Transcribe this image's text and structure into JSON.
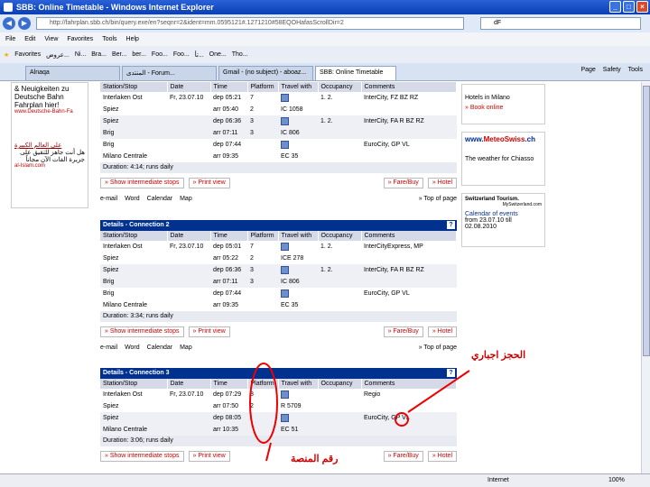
{
  "window": {
    "title": "SBB: Online Timetable - Windows Internet Explorer"
  },
  "address": {
    "url": "http://fahrplan.sbb.ch/bin/query.exe/en?seqnr=2&ident=mm.0595121#.1271210#58EQOHafasScrollDir=2",
    "search": "dF"
  },
  "menu": [
    "File",
    "Edit",
    "View",
    "Favorites",
    "Tools",
    "Help"
  ],
  "favorites": {
    "label": "Favorites",
    "items": [
      "عروض...",
      "Ni...",
      "Bra...",
      "Ber...",
      "ber...",
      "Foo...",
      "Foo...",
      "تأ...",
      "One...",
      "Tho..."
    ]
  },
  "tabs": [
    "Alnaqa",
    "المنتدى - Forum...",
    "Gmail - (no subject) - aboaz...",
    "SBB: Online Timetable"
  ],
  "toolbar": {
    "page": "Page",
    "safety": "Safety",
    "tools": "Tools"
  },
  "left_ad": {
    "text": "& Neuigkeiten zu Deutsche Bahn Fahrplan hier!",
    "link": "www.Deutsche-Bahn-Fa",
    "ar_title": "على العالم الكبيرة",
    "ar_text": "هل أنت جاهز للتقيق على جزيرة الفات الآن مجاناً",
    "ar_link": "al-Islam.com"
  },
  "right": {
    "hotels": "Hotels in Milano",
    "book": "» Book online",
    "meteo1": "www.",
    "meteo2": "MeteoSwiss",
    "meteo3": ".ch",
    "weather": "The weather for Chiasso",
    "st": "Switzerland Tourism.",
    "st_url": "MySwitzerland.com",
    "calendar": "Calendar of events",
    "from": "from 23.07.10 till 02.08.2010"
  },
  "headers": [
    "Station/Stop",
    "Date",
    "Time",
    "Platform",
    "Travel with",
    "Occupancy",
    "Comments"
  ],
  "connections": [
    {
      "title": "",
      "rows": [
        [
          "Interlaken Ost",
          "Fr, 23.07.10",
          "dep 05:21",
          "7",
          "",
          "1. 2.",
          "InterCity, FZ BZ RZ"
        ],
        [
          "Spiez",
          "",
          "arr 05:40",
          "2",
          "IC 1058",
          "",
          ""
        ],
        [
          "Spiez",
          "",
          "dep 06:36",
          "3",
          "",
          "1. 2.",
          "InterCity, FA R BZ RZ"
        ],
        [
          "Brig",
          "",
          "arr 07:11",
          "3",
          "IC 806",
          "",
          ""
        ],
        [
          "Brig",
          "",
          "dep 07:44",
          "",
          "",
          "",
          "EuroCity, GP VL"
        ],
        [
          "Milano Centrale",
          "",
          "arr 09:35",
          "",
          "EC 35",
          "",
          ""
        ]
      ],
      "duration": "Duration: 4:14; runs daily"
    },
    {
      "title": "Details - Connection 2",
      "rows": [
        [
          "Interlaken Ost",
          "Fr, 23.07.10",
          "dep 05:01",
          "7",
          "",
          "1. 2.",
          "InterCityExpress, MP"
        ],
        [
          "Spiez",
          "",
          "arr 05:22",
          "2",
          "ICE 278",
          "",
          ""
        ],
        [
          "Spiez",
          "",
          "dep 06:36",
          "3",
          "",
          "1. 2.",
          "InterCity, FA R BZ RZ"
        ],
        [
          "Brig",
          "",
          "arr 07:11",
          "3",
          "IC 806",
          "",
          ""
        ],
        [
          "Brig",
          "",
          "dep 07:44",
          "",
          "",
          "",
          "EuroCity, GP VL"
        ],
        [
          "Milano Centrale",
          "",
          "arr 09:35",
          "",
          "EC 35",
          "",
          ""
        ]
      ],
      "duration": "Duration: 3:34; runs daily"
    },
    {
      "title": "Details - Connection 3",
      "rows": [
        [
          "Interlaken Ost",
          "Fr, 23.07.10",
          "dep 07:29",
          "8",
          "",
          "",
          "Regio"
        ],
        [
          "Spiez",
          "",
          "arr 07:50",
          "2",
          "R 5709",
          "",
          ""
        ],
        [
          "Spiez",
          "",
          "dep 08:05",
          "",
          "",
          "",
          "EuroCity, GP VL"
        ],
        [
          "Milano Centrale",
          "",
          "arr 10:35",
          "",
          "EC 51",
          "",
          ""
        ]
      ],
      "duration": "Duration: 3:06; runs daily"
    }
  ],
  "buttons": {
    "stops": "Show intermediate stops",
    "print": "Print view",
    "fare": "Fare/Buy",
    "hotel": "Hotel"
  },
  "links": {
    "email": "e-mail",
    "word": "Word",
    "calendar": "Calendar",
    "map": "Map",
    "top": "» Top of page"
  },
  "annotations": {
    "reservation": "الحجز اجباري",
    "platform": "رقم المنصة"
  },
  "status": {
    "zone": "Internet",
    "zoom": "100%"
  }
}
